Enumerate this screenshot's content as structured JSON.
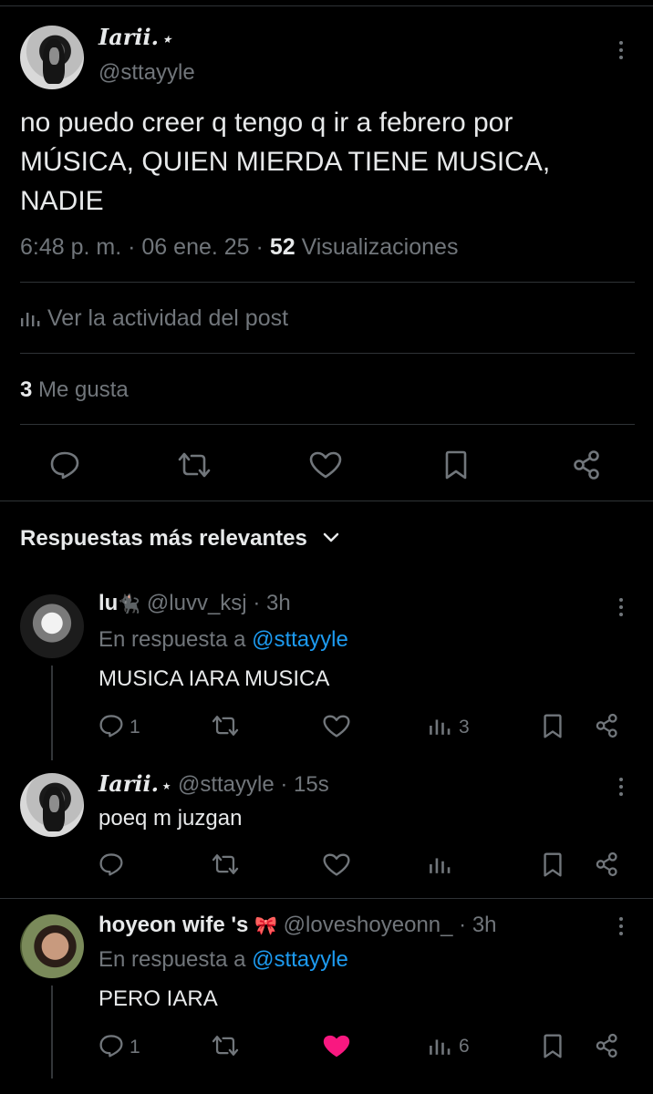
{
  "post": {
    "author_name": "Iarii.",
    "author_decoration": "⋆",
    "handle": "@sttayyle",
    "text_line1": "no puedo creer q tengo q ir a febrero por",
    "text_line2": "MÚSICA, QUIEN MIERDA TIENE MUSICA,",
    "text_line3": "NADIE",
    "time": "6:48 p. m.",
    "date": "06 ene. 25",
    "views_count": "52",
    "views_label": "Visualizaciones",
    "activity_label": "Ver la actividad del post",
    "likes_count": "3",
    "likes_label": "Me gusta"
  },
  "replies_header": "Respuestas más relevantes",
  "replies": [
    {
      "name": "lu",
      "emoji": "🐈‍⬛",
      "handle": "@luvv_ksj",
      "time": "3h",
      "reply_to_label": "En respuesta a",
      "reply_to_handle": "@sttayyle",
      "text": "MUSICA IARA MUSICA",
      "reply_count": "1",
      "views": "3"
    },
    {
      "name": "Iarii.",
      "emoji": "⋆",
      "handle": "@sttayyle",
      "time": "15s",
      "text": "poeq m juzgan"
    },
    {
      "name": "hoyeon wife 's",
      "emoji": "🎀",
      "handle": "@loveshoyeonn_",
      "time": "3h",
      "reply_to_label": "En respuesta a",
      "reply_to_handle": "@sttayyle",
      "text": "PERO IARA",
      "reply_count": "1",
      "views": "6"
    }
  ],
  "colors": {
    "background": "#000000",
    "text": "#e7e9ea",
    "muted": "#71767b",
    "link": "#1d9bf0",
    "like_active": "#f91880",
    "divider": "#2f3336"
  },
  "icons": [
    "more-icon",
    "analytics-icon",
    "reply-icon",
    "retweet-icon",
    "like-icon",
    "bookmark-icon",
    "share-icon",
    "chevron-down-icon"
  ]
}
